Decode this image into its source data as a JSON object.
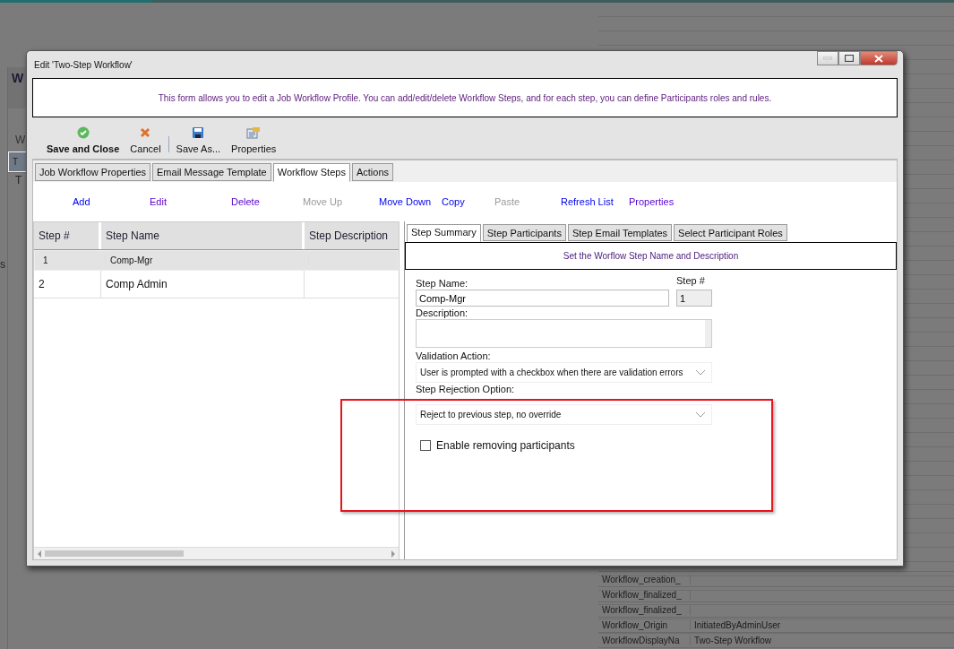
{
  "background": {
    "left_fragments": [
      {
        "text": "W",
        "kind": "heading"
      },
      {
        "text": "W",
        "kind": "label"
      },
      {
        "text": "T",
        "kind": "row",
        "selected": true
      },
      {
        "text": "T",
        "kind": "row",
        "selected": false
      }
    ],
    "side_fragment": "s",
    "table_rows": [
      {
        "name": "Workflow_creation_",
        "value": ""
      },
      {
        "name": "Workflow_finalized_",
        "value": ""
      },
      {
        "name": "Workflow_finalized_",
        "value": ""
      },
      {
        "name": "Workflow_Origin",
        "value": "InitiatedByAdminUser"
      },
      {
        "name": "WorkflowDisplayNa",
        "value": "Two-Step Workflow"
      }
    ]
  },
  "window": {
    "title": "Edit 'Two-Step Workflow'"
  },
  "info": "This form allows you to edit a Job Workflow Profile. You can add/edit/delete Workflow Steps, and for each step, you can define Participants roles and rules.",
  "toolbar": [
    {
      "label": "Save and Close",
      "bold": true
    },
    {
      "label": "Cancel",
      "bold": false
    },
    {
      "label": "Save As...",
      "bold": false
    },
    {
      "label": "Properties",
      "bold": false
    }
  ],
  "tabs": [
    {
      "label": "Job Workflow Properties",
      "selected": false
    },
    {
      "label": "Email Message Template",
      "selected": false
    },
    {
      "label": "Workflow Steps",
      "selected": true
    },
    {
      "label": "Actions",
      "selected": false
    }
  ],
  "actions": [
    {
      "label": "Add",
      "disabled": false,
      "visited": false
    },
    {
      "label": "Edit",
      "disabled": false,
      "visited": true
    },
    {
      "label": "Delete",
      "disabled": false,
      "visited": true
    },
    {
      "label": "Move Up",
      "disabled": true,
      "visited": false
    },
    {
      "label": "Move Down",
      "disabled": false,
      "visited": false
    },
    {
      "label": "Copy",
      "disabled": false,
      "visited": false
    },
    {
      "label": "Paste",
      "disabled": true,
      "visited": false
    },
    {
      "label": "Refresh List",
      "disabled": false,
      "visited": false
    },
    {
      "label": "Properties",
      "disabled": false,
      "visited": true
    }
  ],
  "steps_table": {
    "columns": [
      "Step #",
      "Step Name",
      "Step Description"
    ],
    "rows": [
      {
        "cells": [
          "1",
          "Comp-Mgr",
          ""
        ],
        "selected": true
      },
      {
        "cells": [
          "2",
          "Comp Admin",
          ""
        ],
        "selected": false
      }
    ]
  },
  "step_tabs": [
    {
      "label": "Step Summary",
      "selected": true
    },
    {
      "label": "Step Participants",
      "selected": false
    },
    {
      "label": "Step Email Templates",
      "selected": false
    },
    {
      "label": "Select Participant Roles",
      "selected": false
    }
  ],
  "step_header": "Set the Worflow Step Name and Description",
  "form": {
    "step_name_label": "Step Name:",
    "step_name": "Comp-Mgr",
    "step_no_label": "Step #",
    "step_no": "1",
    "description_label": "Description:",
    "validation_label": "Validation Action:",
    "validation_value": "User is prompted with a checkbox when there are validation errors",
    "rejection_label": "Step Rejection Option:",
    "rejection_value": "Reject to previous step, no override",
    "checkbox": {
      "label": "Enable removing participants",
      "checked": false
    }
  },
  "highlight": {
    "shown": true
  }
}
